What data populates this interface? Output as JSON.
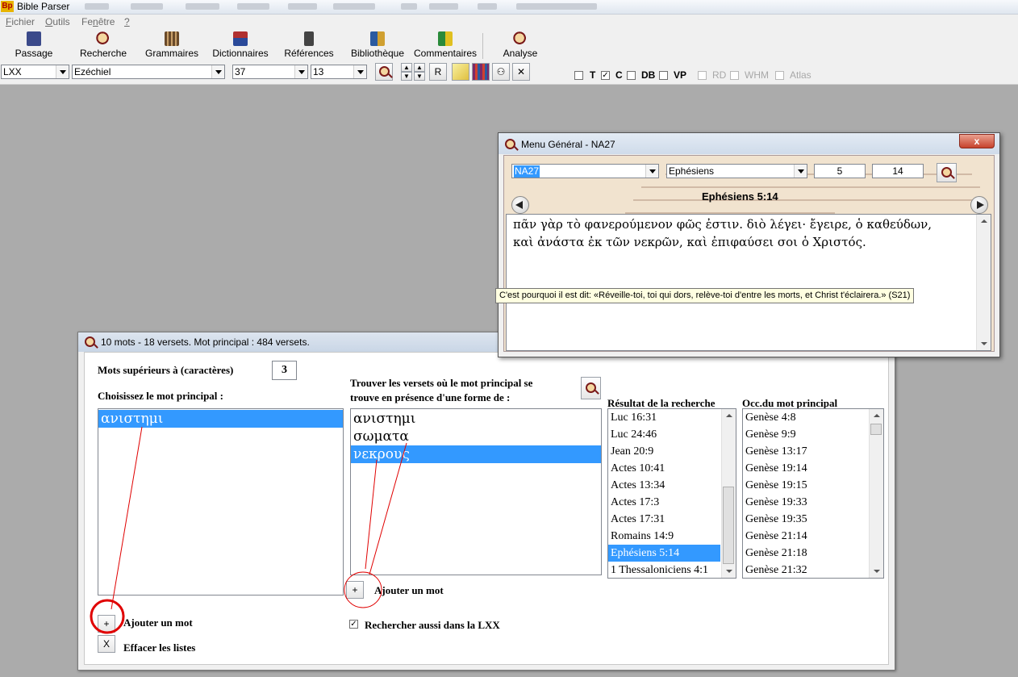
{
  "app": {
    "title": "Bible Parser",
    "icon_text": "Bp"
  },
  "menubar": [
    {
      "label_pre": "",
      "label_u": "F",
      "label_post": "ichier"
    },
    {
      "label_pre": "",
      "label_u": "O",
      "label_post": "utils"
    },
    {
      "label_pre": "Fe",
      "label_u": "n",
      "label_post": "être"
    },
    {
      "label_pre": "",
      "label_u": "?",
      "label_post": ""
    }
  ],
  "toolbar": {
    "items": [
      {
        "label": "Passage",
        "icon": "book-icon",
        "color": "#3b4a8a"
      },
      {
        "label": "Recherche",
        "icon": "magnifier-icon",
        "color": "#7a1a1a"
      },
      {
        "label": "Grammaires",
        "icon": "books-icon",
        "color": "#6a4a2a"
      },
      {
        "label": "Dictionnaires",
        "icon": "dictionary-icon",
        "color": "#b03030"
      },
      {
        "label": "Références",
        "icon": "references-icon",
        "color": "#444444"
      },
      {
        "label": "Bibliothèque",
        "icon": "library-icon",
        "color": "#2a5aa0"
      },
      {
        "label": "Commentaires",
        "icon": "commentaries-icon",
        "color": "#2a8a3a"
      },
      {
        "label": "Analyse",
        "icon": "analyse-icon",
        "color": "#7a1a1a"
      }
    ]
  },
  "selectors": {
    "version": "LXX",
    "book": "Ezéchiel",
    "chapter": "37",
    "verse": "13",
    "r_button": "R"
  },
  "checkboxes": [
    {
      "label": "T",
      "checked": false,
      "enabled": true
    },
    {
      "label": "C",
      "checked": true,
      "enabled": true
    },
    {
      "label": "DB",
      "checked": false,
      "enabled": true
    },
    {
      "label": "VP",
      "checked": false,
      "enabled": true
    },
    {
      "label": "RD",
      "checked": false,
      "enabled": false
    },
    {
      "label": "WHM",
      "checked": false,
      "enabled": false
    },
    {
      "label": "Atlas",
      "checked": false,
      "enabled": false
    }
  ],
  "search_window": {
    "title": "10 mots - 18 versets. Mot principal : 484 versets.",
    "min_chars_label": "Mots supérieurs à (caractères)",
    "min_chars_value": "3",
    "choose_main_label": "Choisissez le mot principal :",
    "main_words": [
      "ανιστημι"
    ],
    "find_label_1": "Trouver les versets où le mot principal se",
    "find_label_2": "trouve en présence d'une forme de :",
    "forms": [
      "ανιστημι",
      "σωματα",
      "νεκρους"
    ],
    "add_word_label": "Ajouter un mot",
    "add_button": "+",
    "clear_button": "X",
    "clear_label": "Effacer les listes",
    "lxx_checkbox_label": "Rechercher aussi dans la LXX",
    "results_label": "Résultat de la recherche",
    "results": [
      "Luc 16:31",
      "Luc 24:46",
      "Jean 20:9",
      "Actes 10:41",
      "Actes 13:34",
      "Actes 17:3",
      "Actes 17:31",
      "Romains 14:9",
      "Ephésiens 5:14",
      "1 Thessaloniciens 4:1"
    ],
    "occ_label": "Occ.du mot principal",
    "occurrences": [
      "Genèse 4:8",
      "Genèse 9:9",
      "Genèse 13:17",
      "Genèse 19:14",
      "Genèse 19:15",
      "Genèse 19:33",
      "Genèse 19:35",
      "Genèse 21:14",
      "Genèse 21:18",
      "Genèse 21:32"
    ]
  },
  "menu_window": {
    "title": "Menu Général - NA27",
    "close": "x",
    "version": "NA27",
    "book": "Ephésiens",
    "chapter": "5",
    "verse": "14",
    "reference": "Ephésiens 5:14",
    "text_line1": "πᾶν γὰρ τὸ φανερούμενον φῶς ἐστιν. διὸ λέγει· ἔγειρε, ὁ καθεύδων,",
    "text_line2": "καὶ ἀνάστα ἐκ τῶν νεκρῶν, καὶ ἐπιφαύσει σοι ὁ Χριστός.",
    "tooltip": "C'est pourquoi il est dit: «Réveille-toi, toi qui dors, relève-toi d'entre les morts, et Christ t'éclairera.» (S21)"
  },
  "colors": {
    "selection": "#3399ff",
    "annotation_red": "#e00000"
  }
}
